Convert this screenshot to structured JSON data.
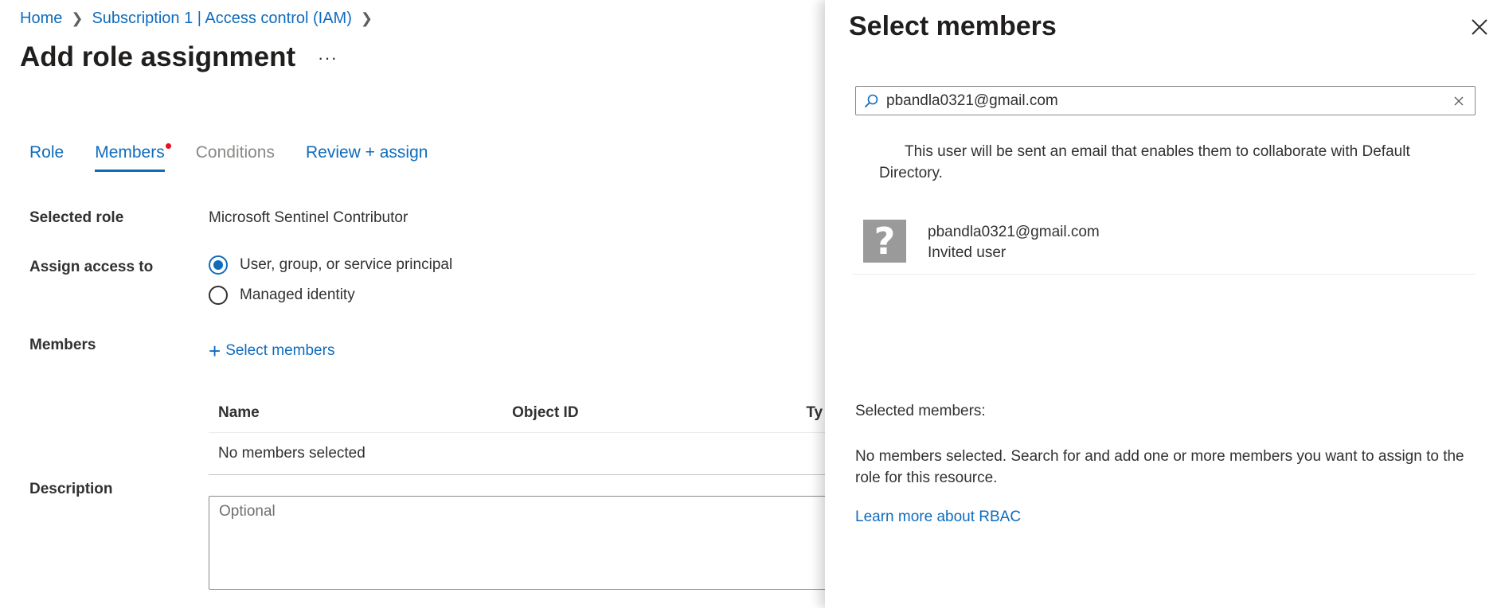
{
  "breadcrumb": {
    "items": [
      "Home",
      "Subscription 1 | Access control (IAM)"
    ]
  },
  "page": {
    "title": "Add role assignment",
    "more": "···"
  },
  "tabs": [
    {
      "label": "Role",
      "state": "link"
    },
    {
      "label": "Members",
      "state": "active"
    },
    {
      "label": "Conditions",
      "state": "disabled"
    },
    {
      "label": "Review + assign",
      "state": "link"
    }
  ],
  "form": {
    "selected_role_label": "Selected role",
    "selected_role_value": "Microsoft Sentinel Contributor",
    "assign_access_label": "Assign access to",
    "assign_options": [
      "User, group, or service principal",
      "Managed identity"
    ],
    "assign_selected": "User, group, or service principal",
    "members_label": "Members",
    "select_members_link": "Select members",
    "description_label": "Description",
    "description_placeholder": "Optional"
  },
  "members_table": {
    "columns": [
      "Name",
      "Object ID",
      "Ty"
    ],
    "empty_text": "No members selected"
  },
  "panel": {
    "title": "Select members",
    "search_value": "pbandla0321@gmail.com",
    "invite_note": "This user will be sent an email that enables them to collaborate with Default Directory.",
    "result": {
      "name": "pbandla0321@gmail.com",
      "subtitle": "Invited user",
      "avatar_glyph": "?"
    },
    "selected_members_label": "Selected members:",
    "none_selected_text": "No members selected. Search for and add one or more members you want to assign to the role for this resource.",
    "learn_more_link": "Learn more about RBAC"
  },
  "colors": {
    "link": "#0f6cbd",
    "required_dot": "#e81123",
    "avatar_bg": "#9a9a9a"
  }
}
